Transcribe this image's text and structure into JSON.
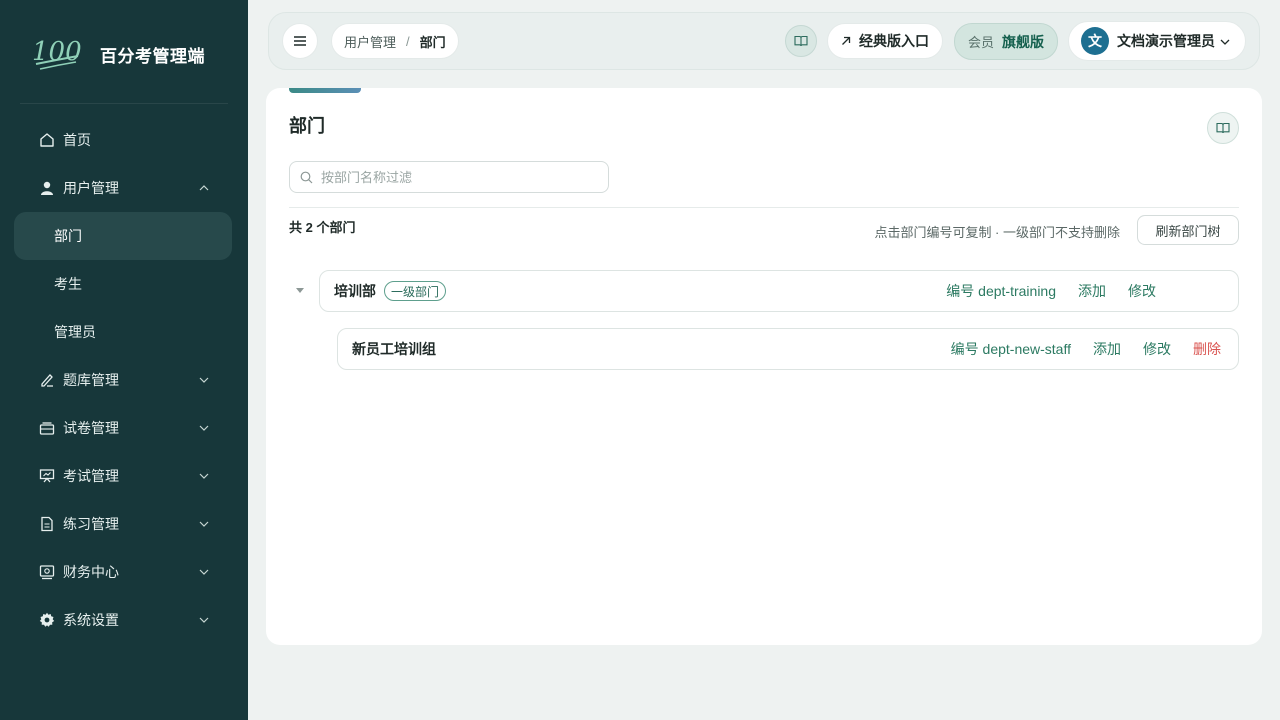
{
  "brand": {
    "logo_text": "100",
    "name": "百分考管理端"
  },
  "sidebar": {
    "items": [
      {
        "label": "首页",
        "icon": "home-icon"
      },
      {
        "label": "用户管理",
        "icon": "user-icon",
        "expanded": true,
        "children": [
          {
            "label": "部门",
            "active": true
          },
          {
            "label": "考生"
          },
          {
            "label": "管理员"
          }
        ]
      },
      {
        "label": "题库管理",
        "icon": "pen-icon"
      },
      {
        "label": "试卷管理",
        "icon": "tray-icon"
      },
      {
        "label": "考试管理",
        "icon": "presentation-icon"
      },
      {
        "label": "练习管理",
        "icon": "document-icon"
      },
      {
        "label": "财务中心",
        "icon": "finance-icon"
      },
      {
        "label": "系统设置",
        "icon": "gear-icon"
      }
    ]
  },
  "header": {
    "breadcrumb": [
      "用户管理",
      "部门"
    ],
    "breadcrumb_separator": "/",
    "classic_entry": "经典版入口",
    "member_label": "会员",
    "member_tier": "旗舰版",
    "user_avatar": "文",
    "user_name": "文档演示管理员"
  },
  "page": {
    "title": "部门",
    "search_placeholder": "按部门名称过滤",
    "count_text": "共 2 个部门",
    "hint": "点击部门编号可复制 · 一级部门不支持删除",
    "refresh_label": "刷新部门树",
    "departments": [
      {
        "name": "培训部",
        "tag": "一级部门",
        "code": "编号 dept-training",
        "actions": [
          "添加",
          "修改"
        ]
      },
      {
        "name": "新员工培训组",
        "code": "编号 dept-new-staff",
        "actions": [
          "添加",
          "修改",
          "删除"
        ]
      }
    ]
  },
  "colors": {
    "sidebar_bg": "#17373a",
    "accent_green": "#2c7a62",
    "danger": "#d9534f",
    "avatar_bg": "#1d6f91"
  }
}
